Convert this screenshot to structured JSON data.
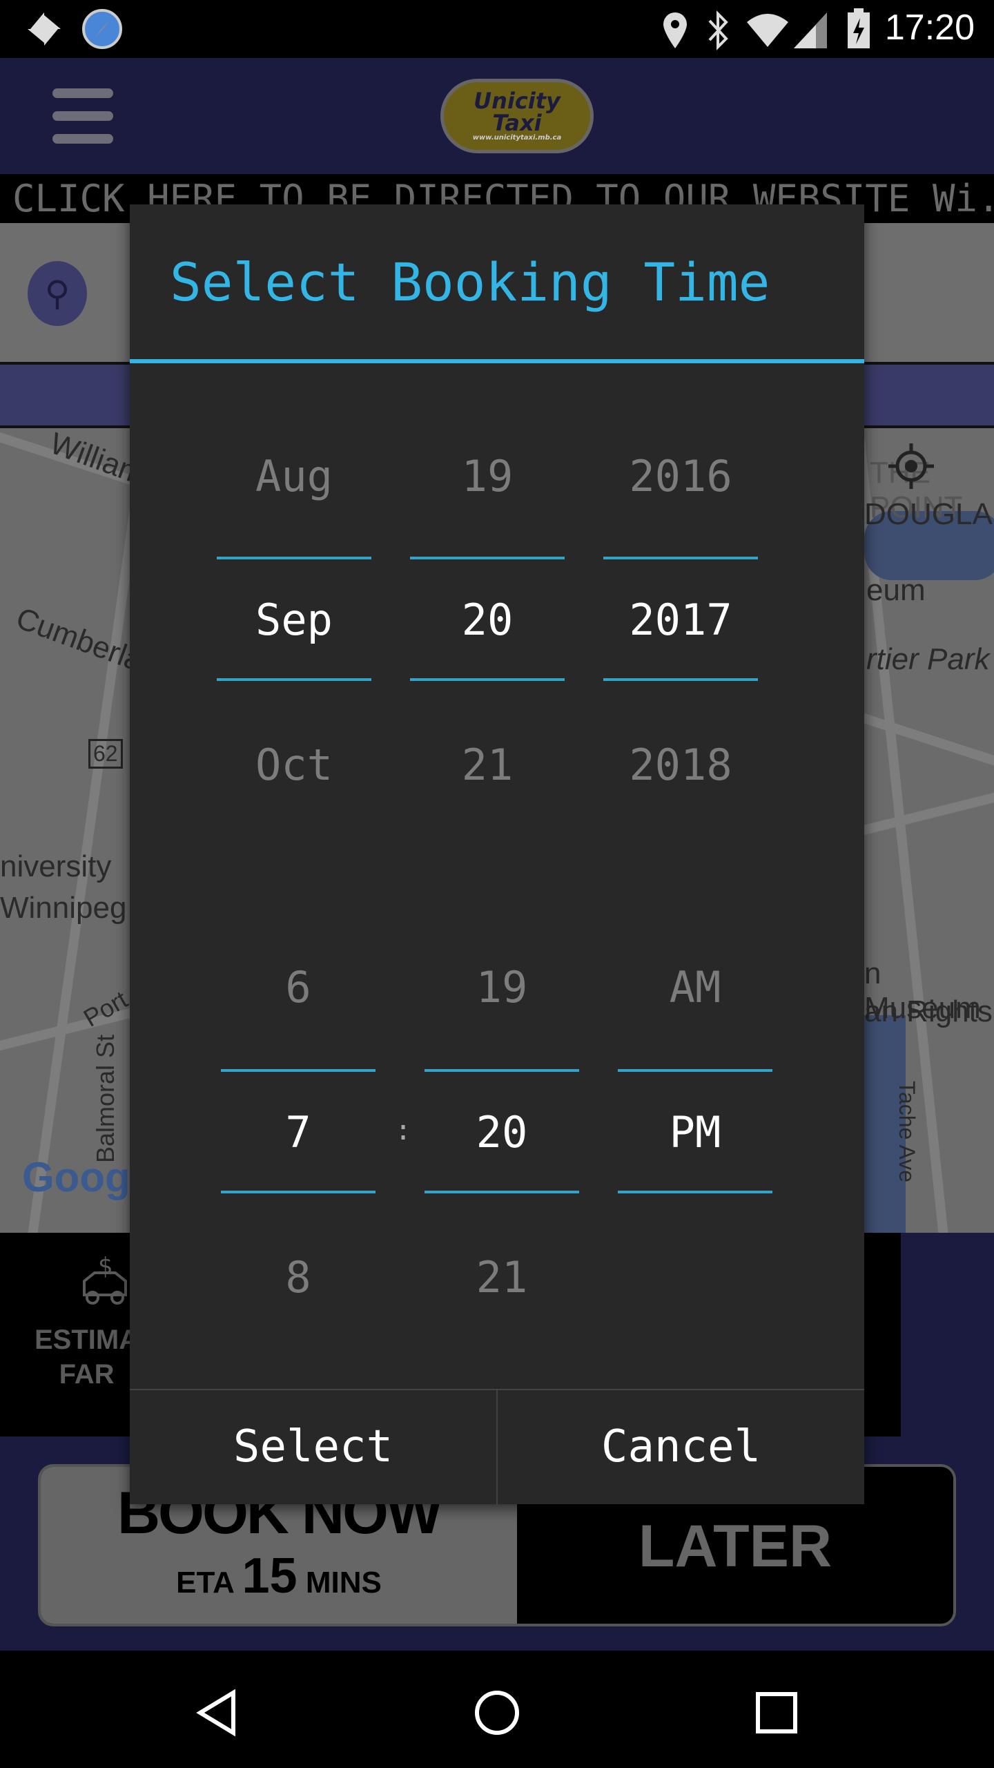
{
  "status_bar": {
    "time": "17:20",
    "icons": [
      "pinwheel-icon",
      "compass-icon",
      "location-icon",
      "bluetooth-icon",
      "wifi-icon",
      "signal-icon",
      "battery-charging-icon"
    ]
  },
  "header": {
    "logo_text": [
      "Unicity",
      "Taxi"
    ],
    "logo_url_text": "www.unicitytaxi.mb.ca"
  },
  "ticker": {
    "text": "CLICK HERE TO BE DIRECTED TO OUR WEBSITE Wi.."
  },
  "map": {
    "labels": [
      "William",
      "Cumberland",
      "62",
      "niversity",
      "Winnipeg",
      "Balmoral St",
      "Port",
      "Google",
      "THE POINT",
      "DOUGLAS",
      "eum",
      "rtier Park",
      "n Museum",
      "an Rights",
      "Tache Ave"
    ]
  },
  "bottom": {
    "estimate_label": [
      "ESTIMA",
      "FAR"
    ],
    "book_now": "BOOK NOW",
    "eta_prefix": "ETA",
    "eta_value": "15",
    "eta_unit": "MINS",
    "later": "LATER"
  },
  "dialog": {
    "title": "Select Booking Time",
    "date": {
      "month": [
        "Aug",
        "Sep",
        "Oct"
      ],
      "day": [
        "19",
        "20",
        "21"
      ],
      "year": [
        "2016",
        "2017",
        "2018"
      ]
    },
    "time": {
      "hour": [
        "6",
        "7",
        "8"
      ],
      "separator": ":",
      "minute": [
        "19",
        "20",
        "21"
      ],
      "ampm": [
        "AM",
        "PM"
      ]
    },
    "select_label": "Select",
    "cancel_label": "Cancel",
    "accent": "#33b5e5"
  }
}
